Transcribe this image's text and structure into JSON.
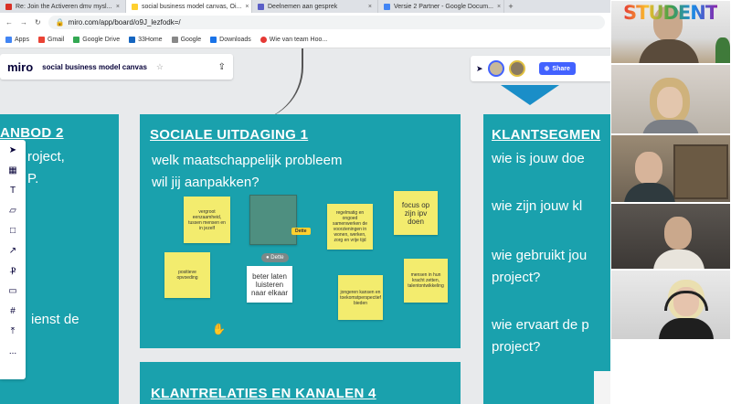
{
  "browser": {
    "tabs": [
      {
        "label": "Re: Join the Activeren dmv mysl...",
        "active": false,
        "color": "#d93025"
      },
      {
        "label": "social business model canvas, Oi...",
        "active": true,
        "color": "#ffd02f"
      },
      {
        "label": "Deelnemen aan gesprek",
        "active": false,
        "color": "#5b5fc7"
      },
      {
        "label": "Versie 2 Partner - Google Docum...",
        "active": false,
        "color": "#4285f4"
      }
    ],
    "url": "miro.com/app/board/o9J_lezfodk=/",
    "bookmarks": [
      "Apps",
      "Gmail",
      "Google Drive",
      "33Home",
      "Google",
      "Downloads",
      "Wie van team Hoo..."
    ]
  },
  "miro": {
    "logo": "miro",
    "board_name": "social business model canvas",
    "share_label": "Share",
    "toolbar_more": "..."
  },
  "canvas": {
    "left_panel": {
      "title_fragment": "ANBOD 2",
      "lines": [
        "roject,",
        "P.",
        "ienst de"
      ]
    },
    "center_panel": {
      "title": "SOCIALE UITDAGING 1",
      "question_line1": "welk maatschappelijk probleem",
      "question_line2": "wil jij aanpakken?"
    },
    "right_panel": {
      "title_fragment": "KLANTSEGMEN",
      "lines": [
        "wie is jouw doe",
        "wie zijn jouw kl",
        "wie gebruikt jou",
        "project?",
        "wie ervaart de p",
        "project?"
      ]
    },
    "bottom_panel": {
      "title": "KLANTRELATIES EN KANALEN 4"
    },
    "stickies": [
      {
        "text": "vergroot eenzaamheid, tussen mensen en in jezelf"
      },
      {
        "text": ""
      },
      {
        "text": "regelmatig en ongoed samenwerken de voorzieningen in wonen, werken, zorg en vrije tijd"
      },
      {
        "text": "focus op zijn ipv doen"
      },
      {
        "text": "positieve opvoeding"
      },
      {
        "text": "beter laten luisteren naar elkaar"
      },
      {
        "text": "mensen in hun kracht zetten, talentontwikkeling"
      },
      {
        "text": "jongeren kansen en toekomstperspectief bieden"
      }
    ],
    "cursor_label": "Dette",
    "selection_label": "Dette"
  },
  "sponsor_logo": "STUDENT",
  "colors": {
    "panel": "#1aa1ad",
    "sticky": "#f3ec6e",
    "miro_blue": "#4262ff"
  }
}
